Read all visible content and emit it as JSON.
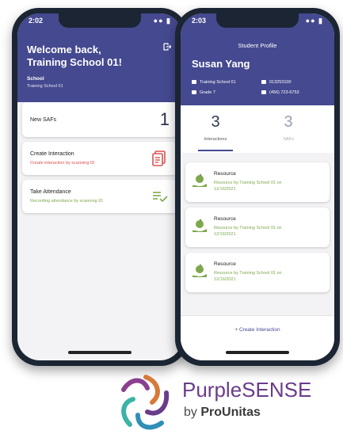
{
  "left_phone": {
    "status_time": "2:02",
    "welcome": "Welcome back,\nTraining School 01!",
    "school_label": "School",
    "school_value": "Training School 01",
    "cards": {
      "new_safs_label": "New SAFs",
      "new_safs_count": "1",
      "create_title": "Create Interaction",
      "create_sub": "Create interaction by scanning ID",
      "attendance_title": "Take Attendance",
      "attendance_sub": "Recording attendance by scanning ID"
    }
  },
  "right_phone": {
    "status_time": "2:03",
    "title": "Student Profile",
    "student_name": "Susan Yang",
    "school": "Training School 01",
    "id_number": "013253100",
    "grade": "Grade 7",
    "phone": "(456) 723-6753",
    "interactions_count": "3",
    "interactions_label": "Interactions",
    "safs_count": "3",
    "safs_label": "SAFs",
    "resources": [
      {
        "title": "Resource",
        "sub": "Resource by Training School 01 on 12/16/2021"
      },
      {
        "title": "Resource",
        "sub": "Resource by Training School 01 on 12/16/2021"
      },
      {
        "title": "Resource",
        "sub": "Resource by Training School 01 on 12/16/2021"
      }
    ],
    "create_interaction": "+ Create Interaction"
  },
  "brand": {
    "name_prefix": "Purple",
    "name_suffix": "SENSE",
    "by": "by ",
    "company": "ProUnitas"
  },
  "colors": {
    "header": "#45498f",
    "accent_red": "#d9534f",
    "accent_green": "#7ea84c",
    "brand_purple": "#6a3c8c"
  }
}
